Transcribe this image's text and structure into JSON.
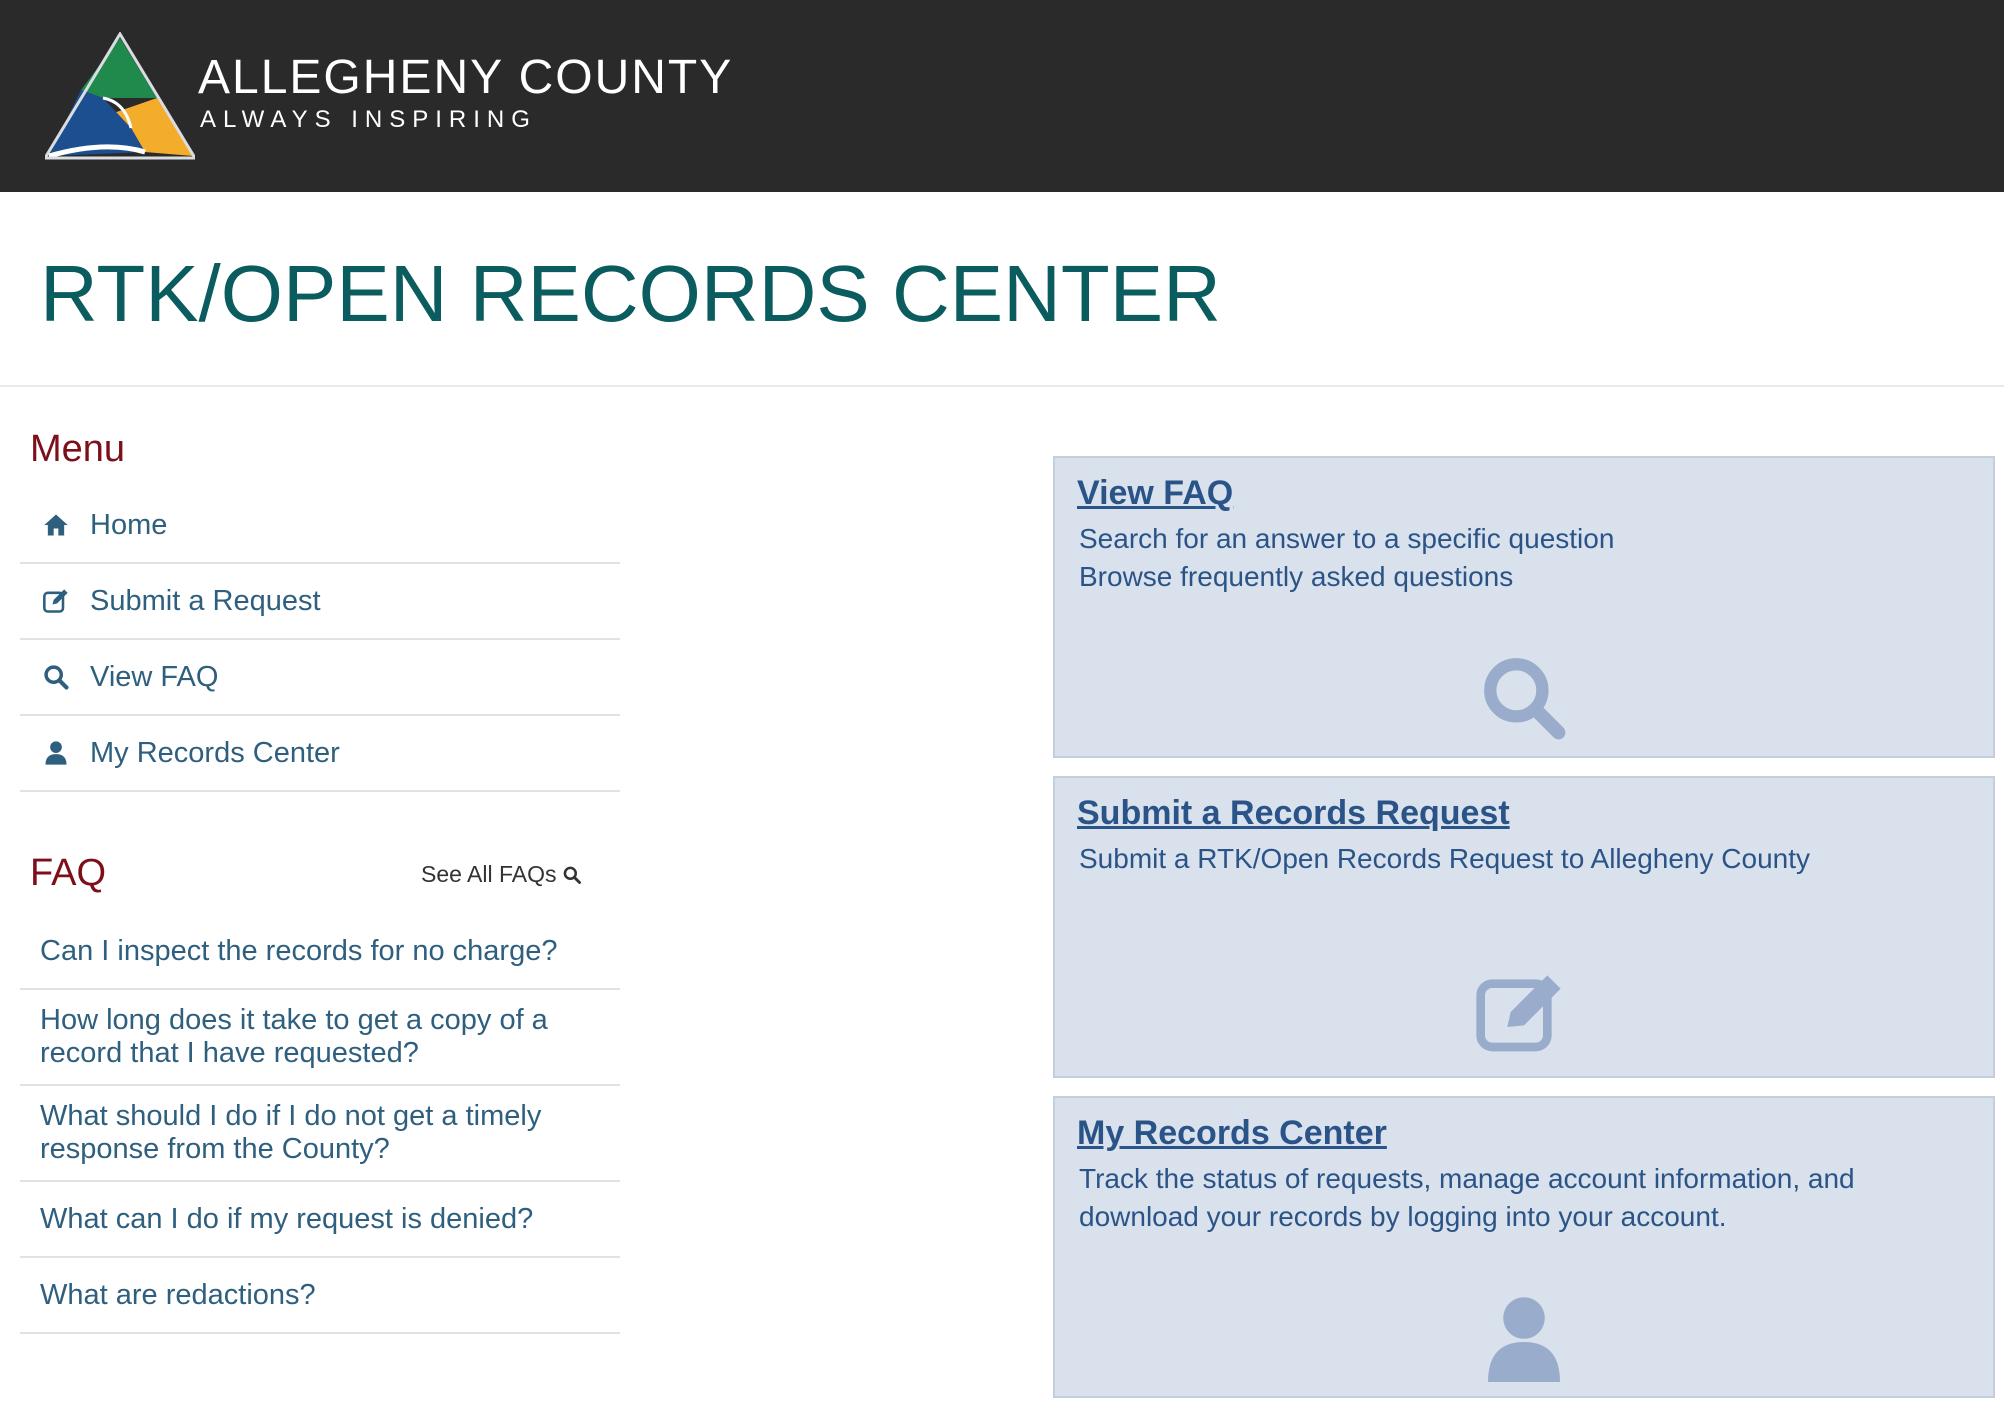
{
  "header": {
    "brand_name": "ALLEGHENY COUNTY",
    "brand_tagline": "ALWAYS INSPIRING",
    "colors": {
      "bar": "#2b2a2b",
      "logo_green": "#1f8a4c",
      "logo_yellow": "#f3ad2b",
      "logo_blue": "#1b4f8f"
    }
  },
  "page": {
    "title": "RTK/OPEN RECORDS CENTER"
  },
  "menu": {
    "heading": "Menu",
    "items": [
      {
        "label": "Home",
        "icon": "home-icon"
      },
      {
        "label": "Submit a Request",
        "icon": "edit-icon"
      },
      {
        "label": "View FAQ",
        "icon": "search-icon"
      },
      {
        "label": "My Records Center",
        "icon": "user-icon"
      }
    ]
  },
  "faq": {
    "heading": "FAQ",
    "see_all_label": "See All FAQs",
    "items": [
      "Can I inspect the records for no charge?",
      "How long does it take to get a copy of a record that I have requested?",
      "What should I do if I do not get a timely response from the County?",
      "What can I do if my request is denied?",
      "What are redactions?"
    ]
  },
  "cards": [
    {
      "title": "View FAQ",
      "lines": [
        "Search for an answer to a specific question",
        "Browse frequently asked questions"
      ],
      "icon": "search-icon"
    },
    {
      "title": "Submit a Records Request",
      "lines": [
        "Submit a RTK/Open Records Request to Allegheny County"
      ],
      "icon": "edit-icon"
    },
    {
      "title": "My Records Center",
      "lines": [
        "Track the status of requests, manage account information, and",
        "download your records by logging into your account."
      ],
      "icon": "user-icon"
    }
  ],
  "colors": {
    "heading_red": "#7d0f1b",
    "title_teal": "#0b5c5e",
    "link_blue": "#2a5488",
    "card_bg": "#d9e1ec",
    "card_icon": "#9aaccb"
  }
}
